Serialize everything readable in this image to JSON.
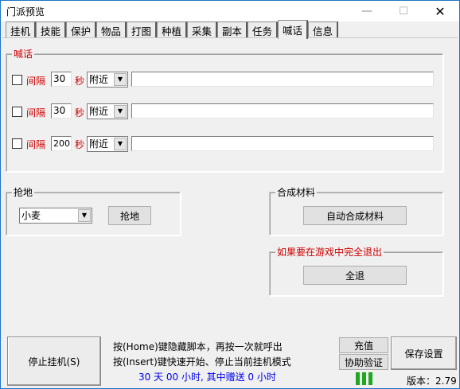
{
  "window": {
    "title": "门派预览"
  },
  "titlebar": {
    "minimize": "—",
    "maximize": "☐",
    "close": "✕"
  },
  "tabs": [
    {
      "label": "挂机"
    },
    {
      "label": "技能"
    },
    {
      "label": "保护"
    },
    {
      "label": "物品"
    },
    {
      "label": "打图"
    },
    {
      "label": "种植"
    },
    {
      "label": "采集"
    },
    {
      "label": "副本"
    },
    {
      "label": "任务"
    },
    {
      "label": "喊话"
    },
    {
      "label": "信息"
    }
  ],
  "shout": {
    "group_title": "喊话",
    "rows": [
      {
        "checked": false,
        "interval_label": "间隔",
        "interval": "30",
        "unit": "秒",
        "channel": "附近",
        "message": ""
      },
      {
        "checked": false,
        "interval_label": "间隔",
        "interval": "30",
        "unit": "秒",
        "channel": "附近",
        "message": ""
      },
      {
        "checked": false,
        "interval_label": "间隔",
        "interval": "200",
        "unit": "秒",
        "channel": "附近",
        "message": ""
      }
    ]
  },
  "grab": {
    "group_title": "抢地",
    "crop": "小麦",
    "button": "抢地"
  },
  "synth": {
    "group_title": "合成材料",
    "button": "自动合成材料"
  },
  "exit": {
    "group_title": "如果要在游戏中完全退出",
    "button": "全退"
  },
  "footer": {
    "stop_button": "停止挂机(S)",
    "hint_line1": "按(Home)键隐藏脚本，再按一次就呼出",
    "hint_line2": "按(Insert)键快速开始、停止当前挂机模式",
    "time_line": "30 天 00 小时, 其中赠送 0 小时",
    "recharge_button": "充值",
    "assist_button": "协助验证",
    "save_button": "保存设置",
    "version": "版本：2.79"
  }
}
